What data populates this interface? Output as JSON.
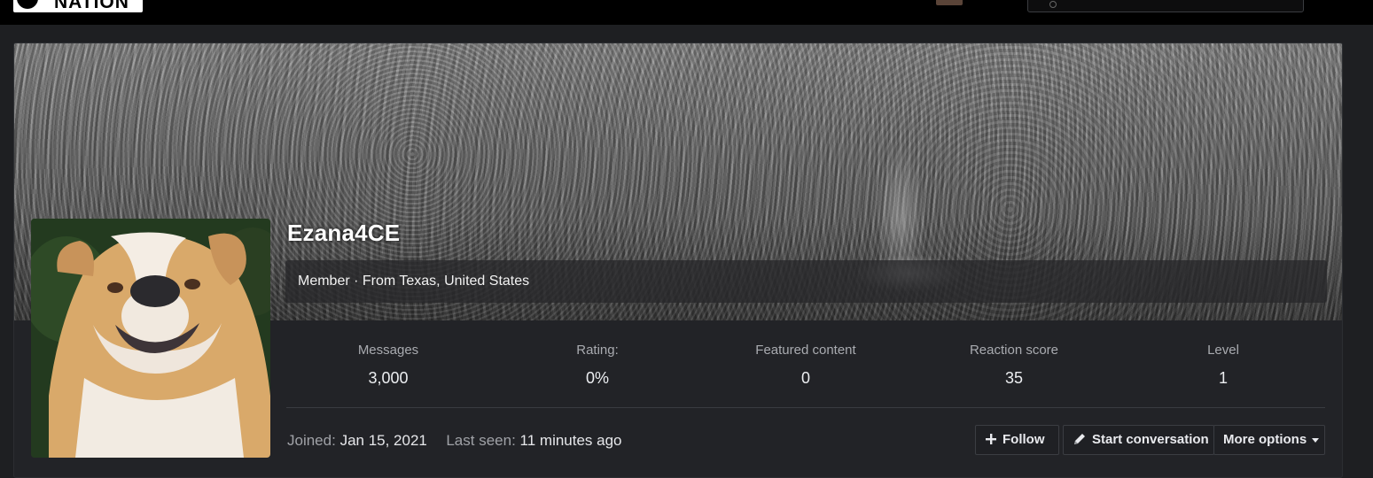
{
  "header": {
    "logo_text": "NATION",
    "search_icon": "search-icon"
  },
  "profile": {
    "username": "Ezana4CE",
    "member_line": "Member · From Texas, United States",
    "avatar_description_icon": "avatar-image"
  },
  "stats": [
    {
      "label": "Messages",
      "value": "3,000"
    },
    {
      "label": "Rating:",
      "value": "0%"
    },
    {
      "label": "Featured content",
      "value": "0"
    },
    {
      "label": "Reaction score",
      "value": "35"
    },
    {
      "label": "Level",
      "value": "1"
    }
  ],
  "footer": {
    "joined_label": "Joined:",
    "joined_value": "Jan 15, 2021",
    "last_seen_label": "Last seen:",
    "last_seen_value": "11 minutes ago"
  },
  "actions": {
    "follow_label": "Follow",
    "follow_icon": "plus-icon",
    "start_conversation_label": "Start conversation",
    "start_conversation_icon": "pencil-icon",
    "more_options_label": "More options",
    "more_options_icon": "caret-down-icon"
  }
}
